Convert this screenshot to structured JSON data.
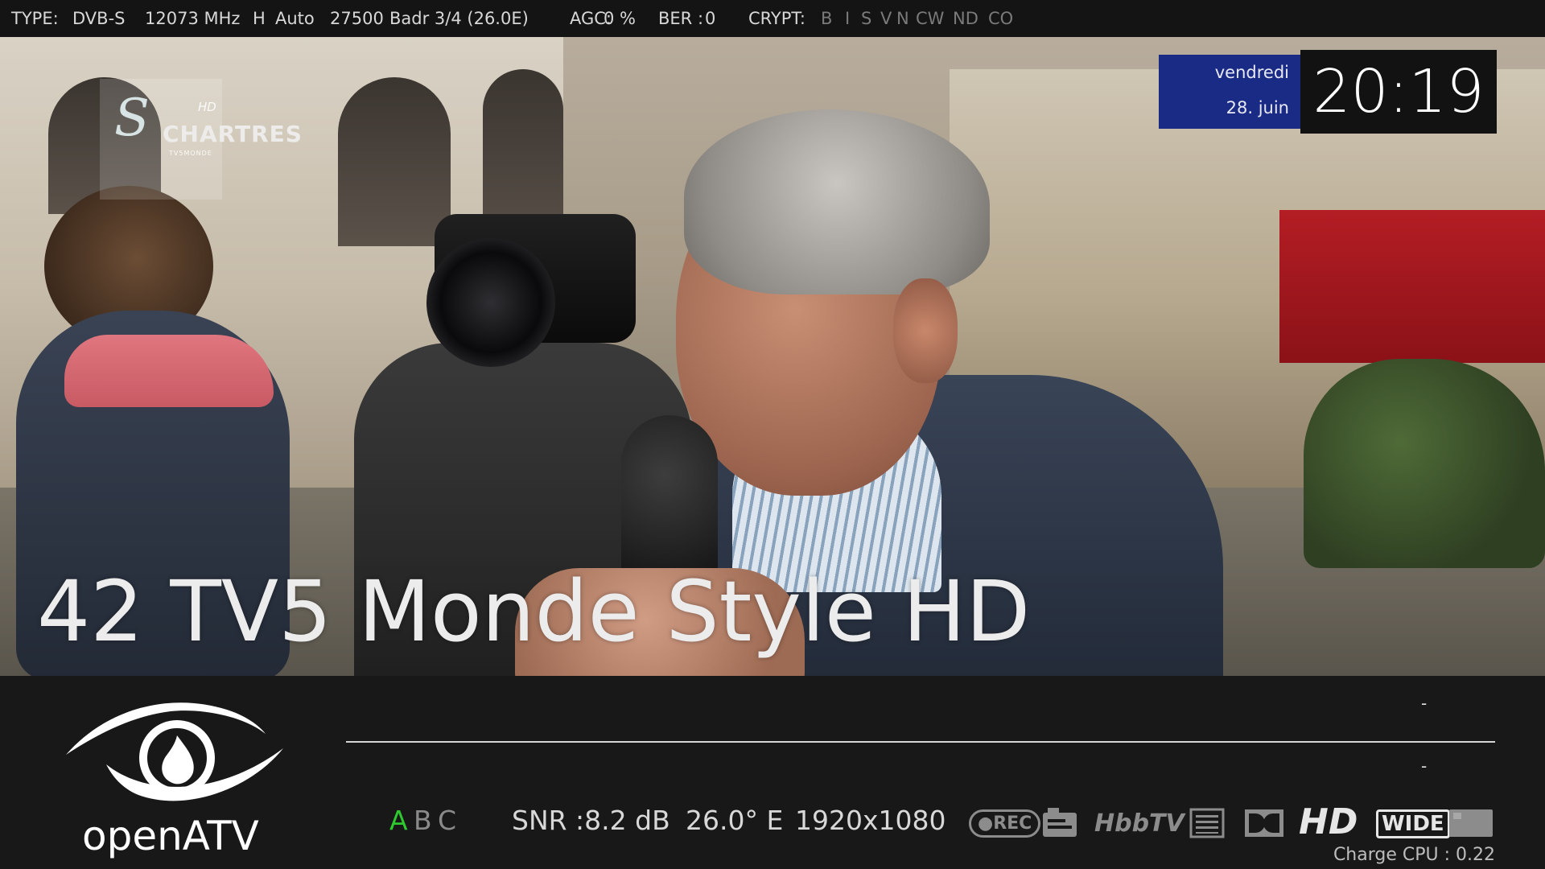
{
  "tuner": {
    "type_label": "TYPE:",
    "type_value": "DVB-S",
    "frequency": "12073 MHz",
    "polarization": "H",
    "inversion": "Auto",
    "symbol_rate": "27500",
    "satellite": "Badr 3/4 (26.0E)",
    "agc_label": "AGC:",
    "agc_value": "0 %",
    "ber_label": "BER :",
    "ber_value": "0",
    "crypt_label": "CRYPT:",
    "crypt_flags": [
      "B",
      "I",
      "S",
      "V",
      "N",
      "CW",
      "ND",
      "CO"
    ]
  },
  "clock": {
    "day": "vendredi",
    "date": "28. juin",
    "time": "20:19"
  },
  "channel": {
    "number": "42",
    "name": "TV5 Monde Style HD",
    "full_title": "42 TV5 Monde Style HD",
    "station_logo": {
      "mark": "S",
      "text": "CHARTRES",
      "hd": "HD",
      "sub": "TV5MONDE"
    }
  },
  "infobar": {
    "brand_name": "openATV",
    "now_event_dash": "-",
    "next_event_dash": "-",
    "ci_slots": [
      "A",
      "B",
      "C"
    ],
    "snr": "SNR :8.2 dB",
    "orbital_position": "26.0° E",
    "resolution": "1920x1080",
    "icons": {
      "rec": "●REC",
      "subtitle_icon": "subtitle-icon",
      "hbbtv": "HbbTV",
      "teletext_icon": "teletext-icon",
      "dolby_icon": "dolby-icon",
      "hd": "HD",
      "wide": "WIDE",
      "crypt_icon": "crypt-icon"
    },
    "cpu_load": "Charge CPU : 0.22"
  },
  "colors": {
    "ci_active": "#2ec92e",
    "date_box": "#1a2b86",
    "bar_bg": "#181818"
  }
}
